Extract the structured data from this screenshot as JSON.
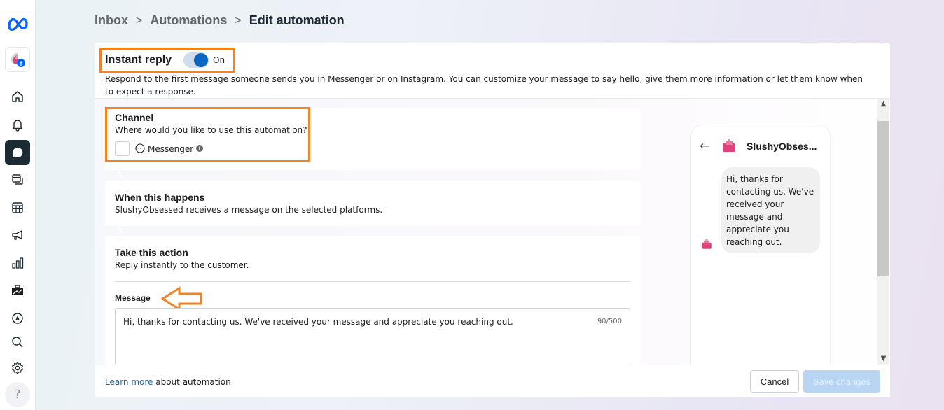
{
  "sidebar": {
    "logo": "meta-logo-icon",
    "page_avatar": "page-avatar-icon",
    "items": [
      {
        "name": "home",
        "icon": "home-icon"
      },
      {
        "name": "notifications",
        "icon": "bell-icon"
      },
      {
        "name": "inbox",
        "icon": "chat-bubble-icon",
        "active": true
      },
      {
        "name": "content",
        "icon": "layers-icon"
      },
      {
        "name": "planner",
        "icon": "table-icon"
      },
      {
        "name": "ads",
        "icon": "megaphone-icon"
      },
      {
        "name": "insights",
        "icon": "bar-chart-icon"
      },
      {
        "name": "tools",
        "icon": "briefcase-icon"
      },
      {
        "name": "ads-manager",
        "icon": "compass-icon"
      },
      {
        "name": "search",
        "icon": "search-icon"
      },
      {
        "name": "settings",
        "icon": "gear-icon"
      }
    ],
    "help_label": "?"
  },
  "breadcrumb": {
    "items": [
      "Inbox",
      "Automations",
      "Edit automation"
    ],
    "separator": ">"
  },
  "header": {
    "title": "Instant reply",
    "toggle_state": "On",
    "toggle_on": true,
    "description": "Respond to the first message someone sends you in Messenger or on Instagram. You can customize your message to say hello, give them more information or let them know when to expect a response."
  },
  "channel": {
    "title": "Channel",
    "subtitle": "Where would you like to use this automation?",
    "option_label": "Messenger",
    "option_checked": false,
    "info_glyph": "i"
  },
  "trigger": {
    "title": "When this happens",
    "subtitle": "SlushyObsessed receives a message on the selected platforms."
  },
  "action": {
    "title": "Take this action",
    "subtitle": "Reply instantly to the customer.",
    "message_label": "Message",
    "message_value": "Hi, thanks for contacting us. We've received your message and appreciate you reaching out.",
    "char_count": "90/500"
  },
  "preview": {
    "back_glyph": "←",
    "page_name": "SlushyObses...",
    "bubble_text": "Hi, thanks for contacting us. We've received your message and appreciate you reaching out."
  },
  "scrollbar": {
    "up": "⌃",
    "down": "⌄"
  },
  "footer": {
    "learn_more_link": "Learn more",
    "learn_more_suffix": " about automation",
    "cancel_label": "Cancel",
    "save_label": "Save changes"
  },
  "colors": {
    "highlight": "#f5821f",
    "toggle_on": "#0a66c2",
    "save_disabled": "#b8d5f3",
    "link": "#1d6ba4"
  }
}
